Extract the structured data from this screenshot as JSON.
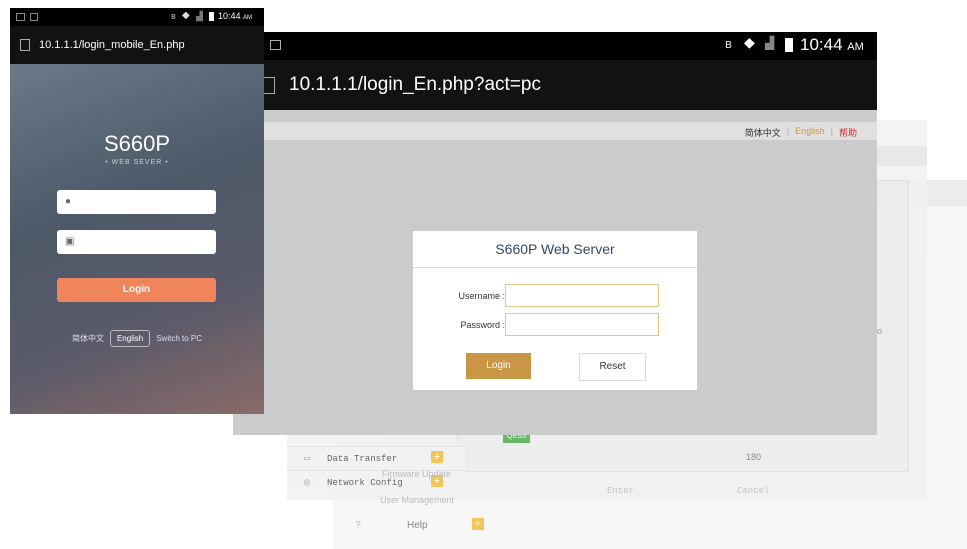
{
  "colors": {
    "login_orange": "#f0855c",
    "tablet_login": "#c99645",
    "accent_red": "#d8232a"
  },
  "background": {
    "menu": [
      {
        "label": "Data Transfer",
        "icon": "monitor-icon"
      },
      {
        "label": "Network Config",
        "icon": "globe-icon"
      }
    ],
    "ghost_labels": [
      "Firmware Update",
      "User Management"
    ],
    "help_label": "Help",
    "numbers": [
      "180"
    ],
    "buttons": [
      "Enter",
      "Cancel"
    ],
    "badge": "QESS",
    "right_letter": "o"
  },
  "phone": {
    "status_time": "10:44",
    "status_ampm": "AM",
    "url": "10.1.1.1/login_mobile_En.php",
    "title": "S660P",
    "subtitle": "• WEB SEVER •",
    "login_label": "Login",
    "lang_zh": "简体中文",
    "lang_en": "English",
    "switch_pc": "Switch to PC"
  },
  "tablet": {
    "status_time": "10:44",
    "status_ampm": "AM",
    "url": "10.1.1.1/login_En.php?act=pc",
    "lang_zh": "简体中文",
    "lang_en": "English",
    "help": "帮助",
    "card_title": "S660P Web Server",
    "username_label": "Username :",
    "password_label": "Password :",
    "login_label": "Login",
    "reset_label": "Reset"
  }
}
